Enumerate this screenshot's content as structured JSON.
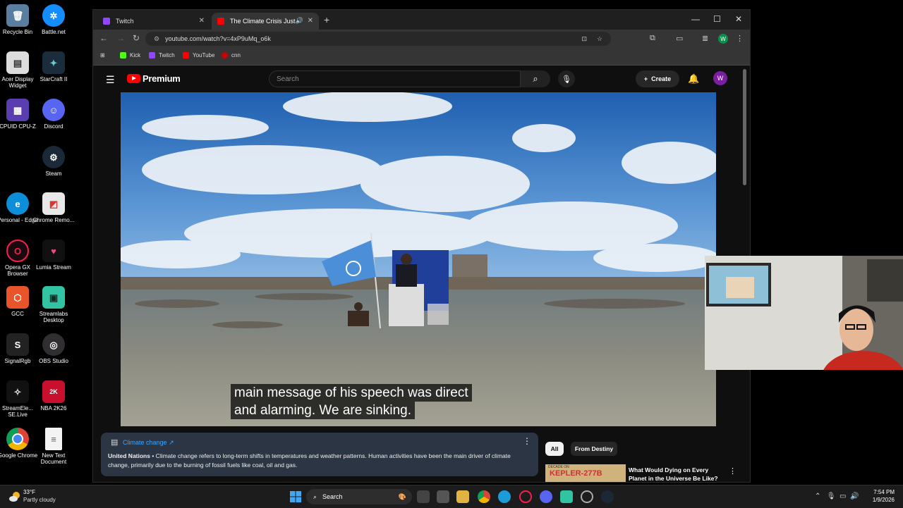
{
  "desktop": {
    "icons": [
      {
        "label": "Recycle Bin"
      },
      {
        "label": "Battle.net"
      },
      {
        "label": "Acer Display Widget"
      },
      {
        "label": "StarCraft II"
      },
      {
        "label": "CPUID CPU-Z"
      },
      {
        "label": "Discord"
      },
      {
        "label": "Steam"
      },
      {
        "label": "Personal - Edge"
      },
      {
        "label": "Chrome Remo..."
      },
      {
        "label": "Opera GX Browser"
      },
      {
        "label": "Lumia Stream"
      },
      {
        "label": "GCC"
      },
      {
        "label": "Streamlabs Desktop"
      },
      {
        "label": "SignalRgb"
      },
      {
        "label": "OBS Studio"
      },
      {
        "label": "StreamEle... SE.Live"
      },
      {
        "label": "NBA 2K26"
      },
      {
        "label": "Google Chrome"
      },
      {
        "label": "New Text Document"
      }
    ]
  },
  "browser": {
    "tabs": [
      {
        "title": "Twitch",
        "active": false
      },
      {
        "title": "The Climate Crisis Just Hit a",
        "active": true
      }
    ],
    "url": "youtube.com/watch?v=4xP9uMq_o6k",
    "profile_initial": "W",
    "bookmarks": [
      {
        "label": "Kick",
        "color": "#53fc18"
      },
      {
        "label": "Twitch",
        "color": "#9146ff"
      },
      {
        "label": "YouTube",
        "color": "#ff0000"
      },
      {
        "label": "cnn",
        "color": "#cc0000"
      }
    ]
  },
  "youtube": {
    "logo_text": "Premium",
    "search_placeholder": "Search",
    "create_label": "Create",
    "avatar_initial": "W",
    "caption_line1": "main message of his speech was direct",
    "caption_line2": "and alarming. We are sinking.",
    "info_card": {
      "topic": "Climate change",
      "source": "United Nations",
      "text": " • Climate change refers to long-term shifts in temperatures and weather patterns. Human activities have been the main driver of climate change, primarily due to the burning of fossil fuels like coal, oil and gas."
    },
    "chips": [
      "All",
      "From Destiny"
    ],
    "recommendation": {
      "thumb_top": "DECADE ON",
      "thumb_title": "KEPLER-277B",
      "title": "What Would Dying on Every Planet in the Universe Be Like?"
    }
  },
  "taskbar": {
    "weather_temp": "33°F",
    "weather_desc": "Partly cloudy",
    "search_label": "Search",
    "time": "7:54 PM",
    "date": "1/9/2026"
  }
}
